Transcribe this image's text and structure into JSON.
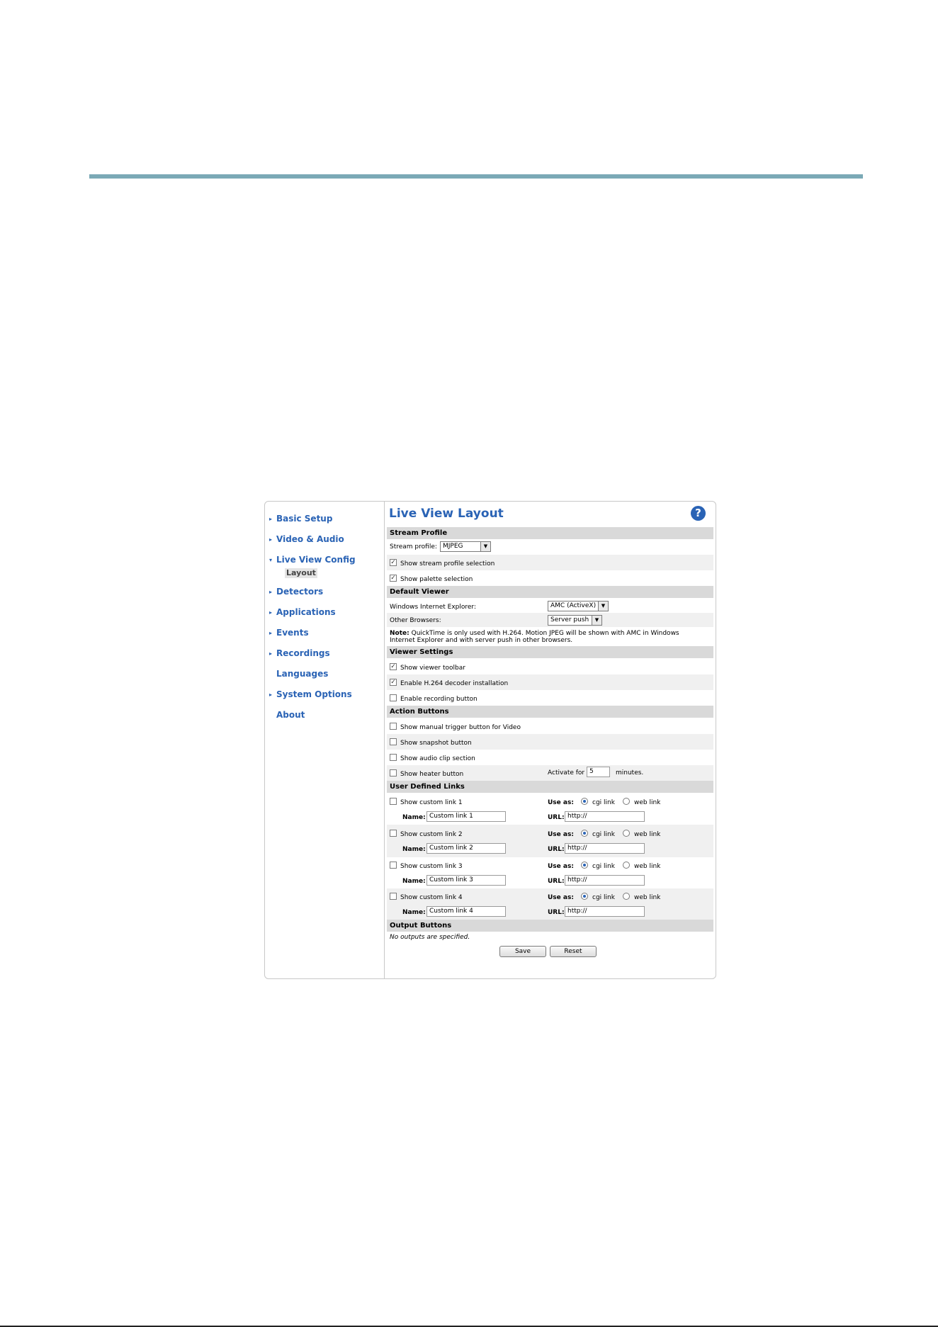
{
  "sidebar": {
    "items": [
      {
        "label": "Basic Setup",
        "arrow": "▸"
      },
      {
        "label": "Video & Audio",
        "arrow": "▸"
      },
      {
        "label": "Live View Config",
        "arrow": "▾"
      },
      {
        "label": "Detectors",
        "arrow": "▸"
      },
      {
        "label": "Applications",
        "arrow": "▸"
      },
      {
        "label": "Events",
        "arrow": "▸"
      },
      {
        "label": "Recordings",
        "arrow": "▸"
      },
      {
        "label": "Languages",
        "arrow": ""
      },
      {
        "label": "System Options",
        "arrow": "▸"
      },
      {
        "label": "About",
        "arrow": ""
      }
    ],
    "subitem": "Layout"
  },
  "main": {
    "title": "Live View Layout",
    "help_glyph": "?",
    "stream_profile": {
      "header": "Stream Profile",
      "label": "Stream profile:",
      "value": "MJPEG",
      "show_stream_profile_selection": "Show stream profile selection",
      "show_palette_selection": "Show palette selection"
    },
    "default_viewer": {
      "header": "Default Viewer",
      "ie_label": "Windows Internet Explorer:",
      "ie_value": "AMC (ActiveX)",
      "other_label": "Other Browsers:",
      "other_value": "Server push",
      "note_bold": "Note:",
      "note_line1": "QuickTime is only used with H.264. Motion JPEG will be shown with AMC in Windows",
      "note_line2": "Internet Explorer and with server push in other browsers."
    },
    "viewer_settings": {
      "header": "Viewer Settings",
      "toolbar": "Show viewer toolbar",
      "h264": "Enable H.264 decoder installation",
      "recording": "Enable recording button"
    },
    "action_buttons": {
      "header": "Action Buttons",
      "manual_trigger": "Show manual trigger button for Video",
      "snapshot": "Show snapshot button",
      "audio_clip": "Show audio clip section",
      "heater": "Show heater button",
      "activate_for": "Activate for",
      "activate_value": "5",
      "minutes": "minutes."
    },
    "user_links": {
      "header": "User Defined Links",
      "use_as": "Use as:",
      "cgi": "cgi link",
      "web": "web link",
      "name_label": "Name:",
      "url_label": "URL:",
      "links": [
        {
          "label": "Show custom link 1",
          "name": "Custom link 1",
          "url": "http://"
        },
        {
          "label": "Show custom link 2",
          "name": "Custom link 2",
          "url": "http://"
        },
        {
          "label": "Show custom link 3",
          "name": "Custom link 3",
          "url": "http://"
        },
        {
          "label": "Show custom link 4",
          "name": "Custom link 4",
          "url": "http://"
        }
      ]
    },
    "output_buttons": {
      "header": "Output Buttons",
      "note": "No outputs are specified."
    },
    "save_label": "Save",
    "reset_label": "Reset",
    "check_glyph": "✓",
    "dropdown_glyph": "▼"
  }
}
